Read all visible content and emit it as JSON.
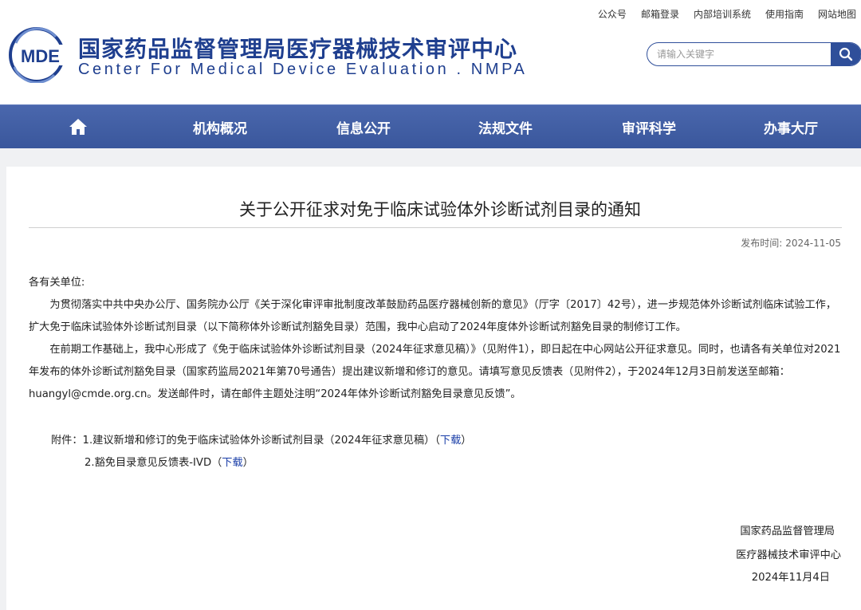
{
  "top_links": [
    "公众号",
    "邮箱登录",
    "内部培训系统",
    "使用指南",
    "网站地图"
  ],
  "logo": {
    "text": "MDE",
    "color": "#1f3f8f"
  },
  "site_title_cn": "国家药品监督管理局医疗器械技术审评中心",
  "site_title_en": "Center For Medical Device Evaluation . NMPA",
  "search": {
    "placeholder": "请输入关键字",
    "icon": "search-icon"
  },
  "nav": {
    "home_icon": "home-icon",
    "items": [
      "机构概况",
      "信息公开",
      "法规文件",
      "审评科学",
      "办事大厅"
    ]
  },
  "article": {
    "title": "关于公开征求对免于临床试验体外诊断试剂目录的通知",
    "publish_label": "发布时间:",
    "publish_date": "2024-11-05",
    "salutation": "各有关单位:",
    "paragraphs": [
      "为贯彻落实中共中央办公厅、国务院办公厅《关于深化审评审批制度改革鼓励药品医疗器械创新的意见》（厅字〔2017〕42号），进一步规范体外诊断试剂临床试验工作，扩大免于临床试验体外诊断试剂目录（以下简称体外诊断试剂豁免目录）范围，我中心启动了2024年度体外诊断试剂豁免目录的制修订工作。",
      "在前期工作基础上，我中心形成了《免于临床试验体外诊断试剂目录（2024年征求意见稿）》（见附件1），即日起在中心网站公开征求意见。同时，也请各有关单位对2021年发布的体外诊断试剂豁免目录（国家药监局2021年第70号通告）提出建议新增和修订的意见。请填写意见反馈表（见附件2），于2024年12月3日前发送至邮箱：huangyl@cmde.org.cn。发送邮件时，请在邮件主题处注明“2024年体外诊断试剂豁免目录意见反馈”。"
    ],
    "attachments": [
      {
        "prefix": "附件：1.建议新增和修订的免于临床试验体外诊断试剂目录（2024年征求意见稿）（",
        "link": "下载",
        "suffix": "）"
      },
      {
        "prefix": "2.豁免目录意见反馈表-IVD（",
        "link": "下载",
        "suffix": "）"
      }
    ],
    "signature": [
      "国家药品监督管理局",
      "医疗器械技术审评中心",
      "2024年11月4日"
    ]
  },
  "colors": {
    "brand_blue": "#1f3f8f",
    "nav_blue": "#3f5ca3",
    "link_blue": "#1a3ea8"
  }
}
